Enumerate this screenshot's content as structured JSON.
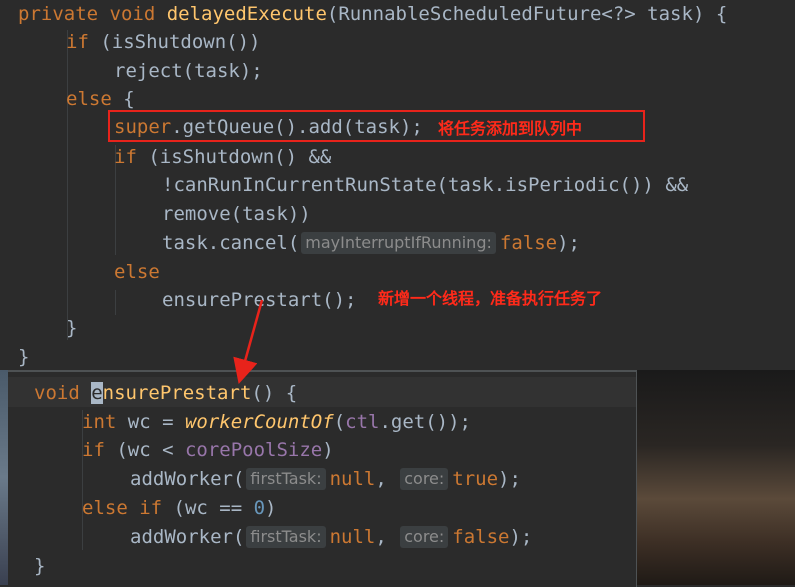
{
  "top_code": {
    "l1": {
      "kw": "private void",
      "fn": "delayedExecute",
      "rest": "(RunnableScheduledFuture<?> task) {"
    },
    "l2": {
      "kw": "if",
      "rest": " (isShutdown())"
    },
    "l3": {
      "rest": "reject(task);"
    },
    "l4": {
      "kw": "else",
      "rest": " {"
    },
    "l5": {
      "kw": "super",
      "rest": ".getQueue().add(task);"
    },
    "l6": {
      "kw": "if",
      "rest": " (isShutdown() &&"
    },
    "l7": {
      "rest": "!canRunInCurrentRunState(task.isPeriodic()) &&"
    },
    "l8": {
      "rest": "remove(task))"
    },
    "l9": {
      "pre": "task.cancel(",
      "hint": "mayInterruptIfRunning:",
      "kw": "false",
      "post": ");"
    },
    "l10": {
      "kw": "else"
    },
    "l11": {
      "rest": "ensurePrestart();"
    },
    "l12": {
      "rest": "}"
    },
    "l13": {
      "rest": "}"
    }
  },
  "annotations": {
    "queue_note": "将任务添加到队列中",
    "thread_note": "新增一个线程，准备执行任务了"
  },
  "bottom_code": {
    "l1": {
      "kw": "void",
      "cursor_char": "e",
      "fn": "nsurePrestart",
      "rest": "() {"
    },
    "l2": {
      "kw": "int",
      "pre": " wc = ",
      "fn_italic": "workerCountOf",
      "open": "(",
      "field": "ctl",
      "post": ".get());"
    },
    "l3": {
      "kw": "if",
      "pre": " (wc < ",
      "field": "corePoolSize",
      "post": ")"
    },
    "l4": {
      "pre": "addWorker(",
      "hint1": "firstTask:",
      "kw1": "null",
      "mid": ", ",
      "hint2": "core:",
      "kw2": "true",
      "post": ");"
    },
    "l5": {
      "kw": "else if",
      "pre": " (wc == ",
      "num": "0",
      "post": ")"
    },
    "l6": {
      "pre": "addWorker(",
      "hint1": "firstTask:",
      "kw1": "null",
      "mid": ", ",
      "hint2": "core:",
      "kw2": "false",
      "post": ");"
    },
    "l7": {
      "rest": "}"
    }
  },
  "colors": {
    "background": "#2b2b2b",
    "keyword": "#cc7832",
    "method": "#ffc66d",
    "field": "#9876aa",
    "number": "#6897bb",
    "annotation": "#e8231b"
  }
}
